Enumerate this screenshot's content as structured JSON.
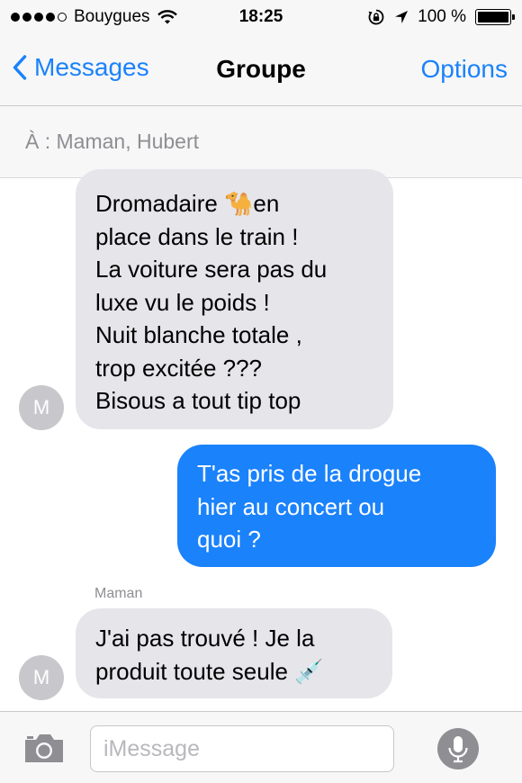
{
  "status_bar": {
    "carrier": "Bouygues",
    "time": "18:25",
    "battery": "100 %",
    "battery_level": 1.0
  },
  "nav": {
    "back_label": "Messages",
    "title": "Groupe",
    "options_label": "Options"
  },
  "recipients": {
    "label": "À :",
    "names": "Maman, Hubert"
  },
  "messages": [
    {
      "direction": "incoming",
      "text": "Dromadaire 🐪en\nplace dans le train !\nLa voiture sera pas du\nluxe vu le poids !\nNuit blanche totale ,\ntrop excitée ???\nBisous a tout tip top",
      "avatar_letter": "M"
    },
    {
      "direction": "outgoing",
      "text": "T'as pris de la drogue\nhier au concert ou\nquoi ?"
    },
    {
      "direction": "incoming",
      "sender": "Maman",
      "text": "J'ai pas trouvé ! Je la\nproduit toute seule 💉",
      "avatar_letter": "M"
    }
  ],
  "input": {
    "placeholder": "iMessage"
  },
  "colors": {
    "accent": "#1a82fb",
    "incoming_bubble": "#e5e5ea",
    "avatar": "#c8c8cc"
  },
  "icons": [
    "signal-dots-icon",
    "wifi-icon",
    "orientation-lock-icon",
    "location-arrow-icon",
    "battery-icon",
    "back-chevron-icon",
    "camera-icon",
    "microphone-icon"
  ]
}
